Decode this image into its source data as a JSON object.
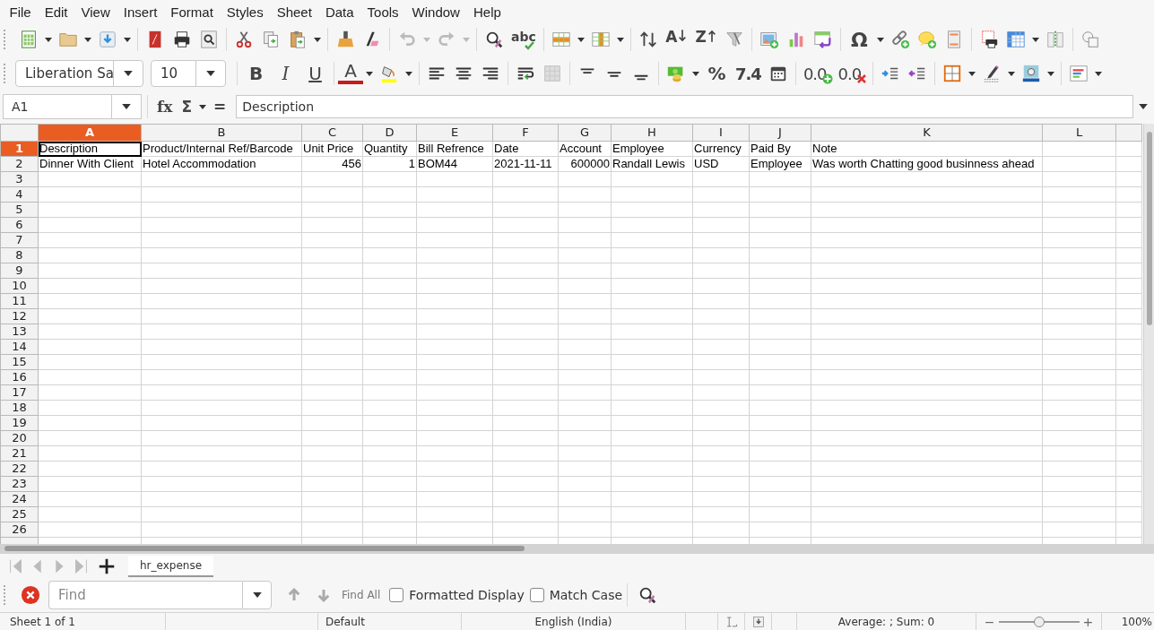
{
  "menu": [
    "File",
    "Edit",
    "View",
    "Insert",
    "Format",
    "Styles",
    "Sheet",
    "Data",
    "Tools",
    "Window",
    "Help"
  ],
  "standard_toolbar": {
    "spelling": "abc",
    "sort_ascending": "A",
    "sort_descending": "Z",
    "special_character": "Ω"
  },
  "formatting_toolbar": {
    "font_name": "Liberation Sa",
    "font_size": "10",
    "bold": "B",
    "italic": "I",
    "underline": "U",
    "font_color": "A",
    "percent": "%",
    "number_format": "7.4",
    "add_decimal": "0.0",
    "delete_decimal": "0.0"
  },
  "formula_bar": {
    "name_box": "A1",
    "function_wizard": "fx",
    "sum": "Σ",
    "formula": "=",
    "content": "Description"
  },
  "sheet": {
    "columns": [
      {
        "label": "A",
        "selected": true
      },
      {
        "label": "B",
        "selected": false
      },
      {
        "label": "C",
        "selected": false
      },
      {
        "label": "D",
        "selected": false
      },
      {
        "label": "E",
        "selected": false
      },
      {
        "label": "F",
        "selected": false
      },
      {
        "label": "G",
        "selected": false
      },
      {
        "label": "H",
        "selected": false
      },
      {
        "label": "I",
        "selected": false
      },
      {
        "label": "J",
        "selected": false
      },
      {
        "label": "K",
        "selected": false
      },
      {
        "label": "L",
        "selected": false
      }
    ],
    "rows": [
      {
        "number": "1",
        "selected": true,
        "cells": [
          {
            "text": "Description",
            "kind": "text",
            "selected": true
          },
          {
            "text": "Product/Internal Ref/Barcode",
            "kind": "text",
            "selected": false
          },
          {
            "text": "Unit Price",
            "kind": "text",
            "selected": false
          },
          {
            "text": "Quantity",
            "kind": "text",
            "selected": false
          },
          {
            "text": "Bill Refrence",
            "kind": "text",
            "selected": false
          },
          {
            "text": "Date",
            "kind": "text",
            "selected": false
          },
          {
            "text": "Account",
            "kind": "text",
            "selected": false
          },
          {
            "text": "Employee",
            "kind": "text",
            "selected": false
          },
          {
            "text": "Currency",
            "kind": "text",
            "selected": false
          },
          {
            "text": "Paid By",
            "kind": "text",
            "selected": false
          },
          {
            "text": "Note",
            "kind": "text",
            "selected": false
          }
        ]
      },
      {
        "number": "2",
        "selected": false,
        "cells": [
          {
            "text": "Dinner With Client",
            "kind": "text",
            "selected": false
          },
          {
            "text": "Hotel Accommodation",
            "kind": "text",
            "selected": false
          },
          {
            "text": "456",
            "kind": "number",
            "selected": false
          },
          {
            "text": "1",
            "kind": "number",
            "selected": false
          },
          {
            "text": "BOM44",
            "kind": "text",
            "selected": false
          },
          {
            "text": "2021-11-11",
            "kind": "text",
            "selected": false
          },
          {
            "text": "600000",
            "kind": "number",
            "selected": false
          },
          {
            "text": "Randall Lewis",
            "kind": "text",
            "selected": false
          },
          {
            "text": "USD",
            "kind": "text",
            "selected": false
          },
          {
            "text": "Employee",
            "kind": "text",
            "selected": false
          },
          {
            "text": "Was worth Chatting good businness ahead",
            "kind": "text",
            "selected": false
          }
        ]
      },
      {
        "number": "3",
        "selected": false
      },
      {
        "number": "4",
        "selected": false
      },
      {
        "number": "5",
        "selected": false
      },
      {
        "number": "6",
        "selected": false
      },
      {
        "number": "7",
        "selected": false
      },
      {
        "number": "8",
        "selected": false
      },
      {
        "number": "9",
        "selected": false
      },
      {
        "number": "10",
        "selected": false
      },
      {
        "number": "11",
        "selected": false
      },
      {
        "number": "12",
        "selected": false
      },
      {
        "number": "13",
        "selected": false
      },
      {
        "number": "14",
        "selected": false
      },
      {
        "number": "15",
        "selected": false
      },
      {
        "number": "16",
        "selected": false
      },
      {
        "number": "17",
        "selected": false
      },
      {
        "number": "18",
        "selected": false
      },
      {
        "number": "19",
        "selected": false
      },
      {
        "number": "20",
        "selected": false
      },
      {
        "number": "21",
        "selected": false
      },
      {
        "number": "22",
        "selected": false
      },
      {
        "number": "23",
        "selected": false
      },
      {
        "number": "24",
        "selected": false
      },
      {
        "number": "25",
        "selected": false
      },
      {
        "number": "26",
        "selected": false
      }
    ]
  },
  "sheet_tabs": [
    {
      "label": "hr_expense",
      "selected": true
    }
  ],
  "find_bar": {
    "placeholder": "Find",
    "find_all": "Find All",
    "options": [
      {
        "label": "Formatted Display",
        "checked": false
      },
      {
        "label": "Match Case",
        "checked": false
      }
    ]
  },
  "status_bar": {
    "sheet": "Sheet 1 of 1",
    "page_style": "Default",
    "language": "English (India)",
    "summary": "Average: ; Sum: 0",
    "zoom_out": "−",
    "zoom_in": "+",
    "zoom": {
      "level": 0.5
    },
    "zoom_percent": "100%"
  }
}
